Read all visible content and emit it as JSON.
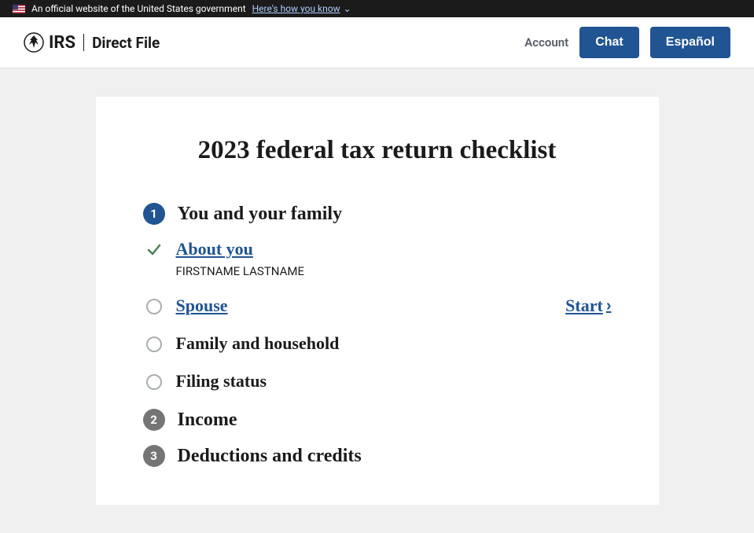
{
  "banner": {
    "text": "An official website of the United States government",
    "link": "Here's how you know"
  },
  "header": {
    "irs": "IRS",
    "product": "Direct File",
    "account": "Account",
    "chat": "Chat",
    "espanol": "Español"
  },
  "page": {
    "title": "2023 federal tax return checklist"
  },
  "sections": [
    {
      "num": "1",
      "title": "You and your family",
      "active": true
    },
    {
      "num": "2",
      "title": "Income",
      "active": false
    },
    {
      "num": "3",
      "title": "Deductions and credits",
      "active": false
    }
  ],
  "items": {
    "about_you": {
      "label": "About you",
      "sub": "FIRSTNAME LASTNAME"
    },
    "spouse": {
      "label": "Spouse",
      "start": "Start"
    },
    "family": {
      "label": "Family and household"
    },
    "filing": {
      "label": "Filing status"
    }
  }
}
